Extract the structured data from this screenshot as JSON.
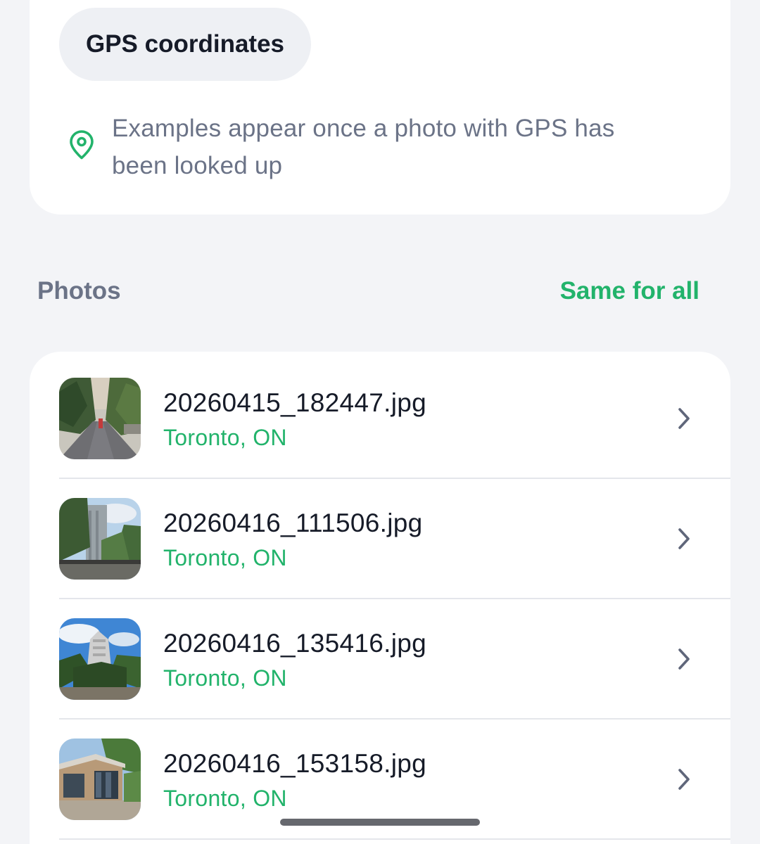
{
  "gps_section": {
    "chip_label": "GPS coordinates",
    "hint": "Examples appear once a photo with GPS has been looked up",
    "icon": "location-pin-icon"
  },
  "photos_section": {
    "title": "Photos",
    "action_label": "Same for all",
    "accent_color": "#22b36b",
    "items": [
      {
        "filename": "20260415_182447.jpg",
        "location": "Toronto, ON"
      },
      {
        "filename": "20260416_111506.jpg",
        "location": "Toronto, ON"
      },
      {
        "filename": "20260416_135416.jpg",
        "location": "Toronto, ON"
      },
      {
        "filename": "20260416_153158.jpg",
        "location": "Toronto, ON"
      }
    ]
  }
}
